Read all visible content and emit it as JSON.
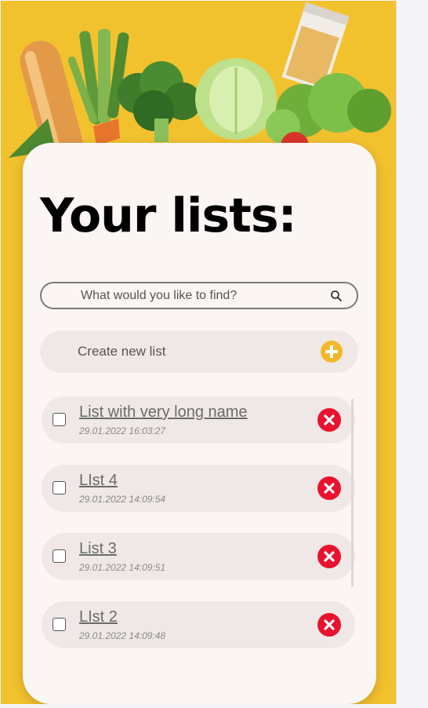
{
  "page": {
    "title": "Your lists:",
    "search": {
      "placeholder": "What would you like to find?"
    },
    "create_label": "Create new list"
  },
  "colors": {
    "background": "#f2c12e",
    "card": "#fbf5f4",
    "item_background": "#efe8e6",
    "accent_plus": "#f2b82a",
    "delete": "#e8132e"
  },
  "icons": {
    "search": "search-icon",
    "create": "plus-circle-icon",
    "delete": "close-circle-icon"
  },
  "lists": [
    {
      "name": "List with very long name",
      "date": "29.01.2022 16:03:27"
    },
    {
      "name": "LIst 4",
      "date": "29.01.2022 14:09:54"
    },
    {
      "name": "List 3",
      "date": "29.01.2022 14:09:51"
    },
    {
      "name": "LIst 2",
      "date": "29.01.2022 14:09:48"
    }
  ]
}
